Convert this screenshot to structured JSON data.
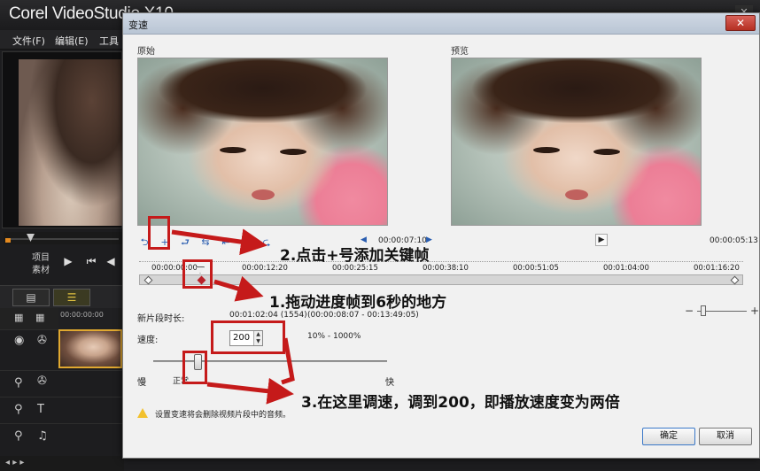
{
  "app": {
    "logo": "Corel VideoStudio X10",
    "close_label": "✕",
    "menu": [
      "文件(F)",
      "编辑(E)",
      "工具"
    ]
  },
  "player": {
    "labels": [
      "项目",
      "素材"
    ]
  },
  "dialog": {
    "title": "变速",
    "close_label": "✕",
    "original_label": "原始",
    "preview_label": "预览",
    "original_timecode": "00:00:07:10",
    "preview_timecode": "00:00:05:13",
    "ruler_ticks": [
      "00:00:00:00",
      "00:00:12:20",
      "00:00:25:15",
      "00:00:38:10",
      "00:00:51:05",
      "00:01:04:00",
      "00:01:16:20"
    ],
    "new_clip_length_label": "新片段时长:",
    "new_clip_length_value": "00:01:02:04 (1554)",
    "new_clip_range": "(00:00:08:07 - 00:13:49:05)",
    "speed_label": "速度:",
    "speed_value": "200",
    "speed_range": "10% - 1000%",
    "slow_label": "慢",
    "normal_label": "正常",
    "fast_label": "快",
    "warning_text": "设置变速将会删除视频片段中的音频。",
    "ok_label": "确定",
    "cancel_label": "取消"
  },
  "annotations": {
    "step1": "1.拖动进度帧到6秒的地方",
    "step2": "2.点击+号添加关键帧",
    "step3": "3.在这里调速，调到200，即播放速度变为两倍"
  },
  "colors": {
    "annotation_red": "#c51a1a",
    "keyframe_red": "#b8222a",
    "dialog_bg": "#f1f1f1",
    "app_bg": "#1d1d1f"
  }
}
